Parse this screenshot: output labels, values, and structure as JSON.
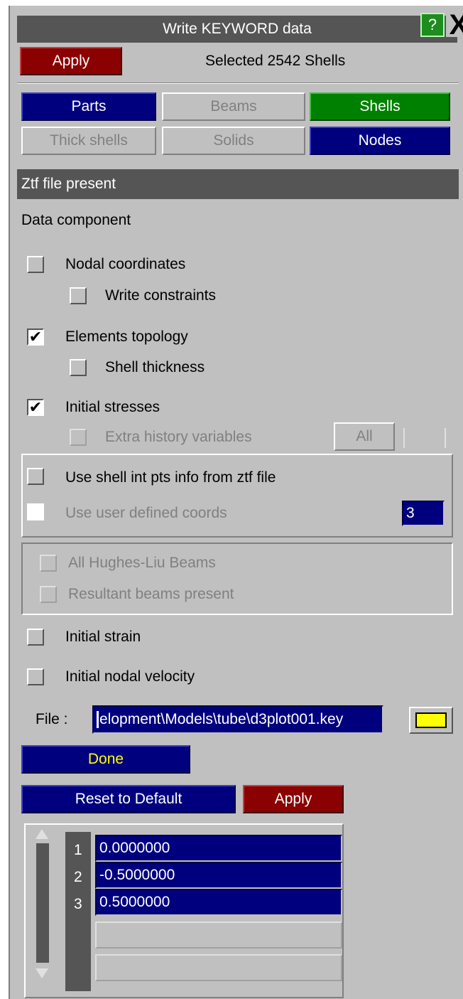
{
  "window": {
    "title": "Write KEYWORD data",
    "help_label": "?",
    "close_label": "X"
  },
  "header": {
    "apply_label": "Apply",
    "status": "Selected 2542 Shells"
  },
  "types": {
    "parts": "Parts",
    "beams": "Beams",
    "shells": "Shells",
    "thick_shells": "Thick shells",
    "solids": "Solids",
    "nodes": "Nodes"
  },
  "ztf_bar": "Ztf file present",
  "data_component": {
    "heading": "Data component",
    "nodal_coordinates": {
      "label": "Nodal coordinates",
      "checked": false
    },
    "write_constraints": {
      "label": "Write constraints",
      "checked": false
    },
    "elements_topology": {
      "label": "Elements topology",
      "checked": true
    },
    "shell_thickness": {
      "label": "Shell thickness",
      "checked": false
    },
    "initial_stresses": {
      "label": "Initial stresses",
      "checked": true
    },
    "extra_history": {
      "label": "Extra history variables",
      "checked": false,
      "all_label": "All"
    }
  },
  "shell_int": {
    "use_ztf": {
      "label": "Use shell int pts info from ztf file",
      "checked": false
    },
    "user_coords": {
      "label": "Use user defined coords",
      "checked": false,
      "value": "3"
    }
  },
  "beams_group": {
    "hughes_liu": "All Hughes-Liu Beams",
    "resultant": "Resultant beams present"
  },
  "initial_strain": {
    "label": "Initial strain",
    "checked": false
  },
  "initial_velocity": {
    "label": "Initial nodal velocity",
    "checked": false
  },
  "file": {
    "label": "File :",
    "value": "elopment\\Models\\tube\\d3plot001.key",
    "folder_icon": "folder-icon"
  },
  "actions": {
    "done": "Done",
    "reset": "Reset to Default",
    "apply": "Apply"
  },
  "coords_list": {
    "rows": [
      {
        "index": "1",
        "value": "0.0000000"
      },
      {
        "index": "2",
        "value": "-0.5000000"
      },
      {
        "index": "3",
        "value": "0.5000000"
      }
    ]
  },
  "colors": {
    "panel": "#c0c0c0",
    "blue": "#00007f",
    "red": "#8b0000",
    "green": "#008000",
    "dark": "#555555"
  }
}
